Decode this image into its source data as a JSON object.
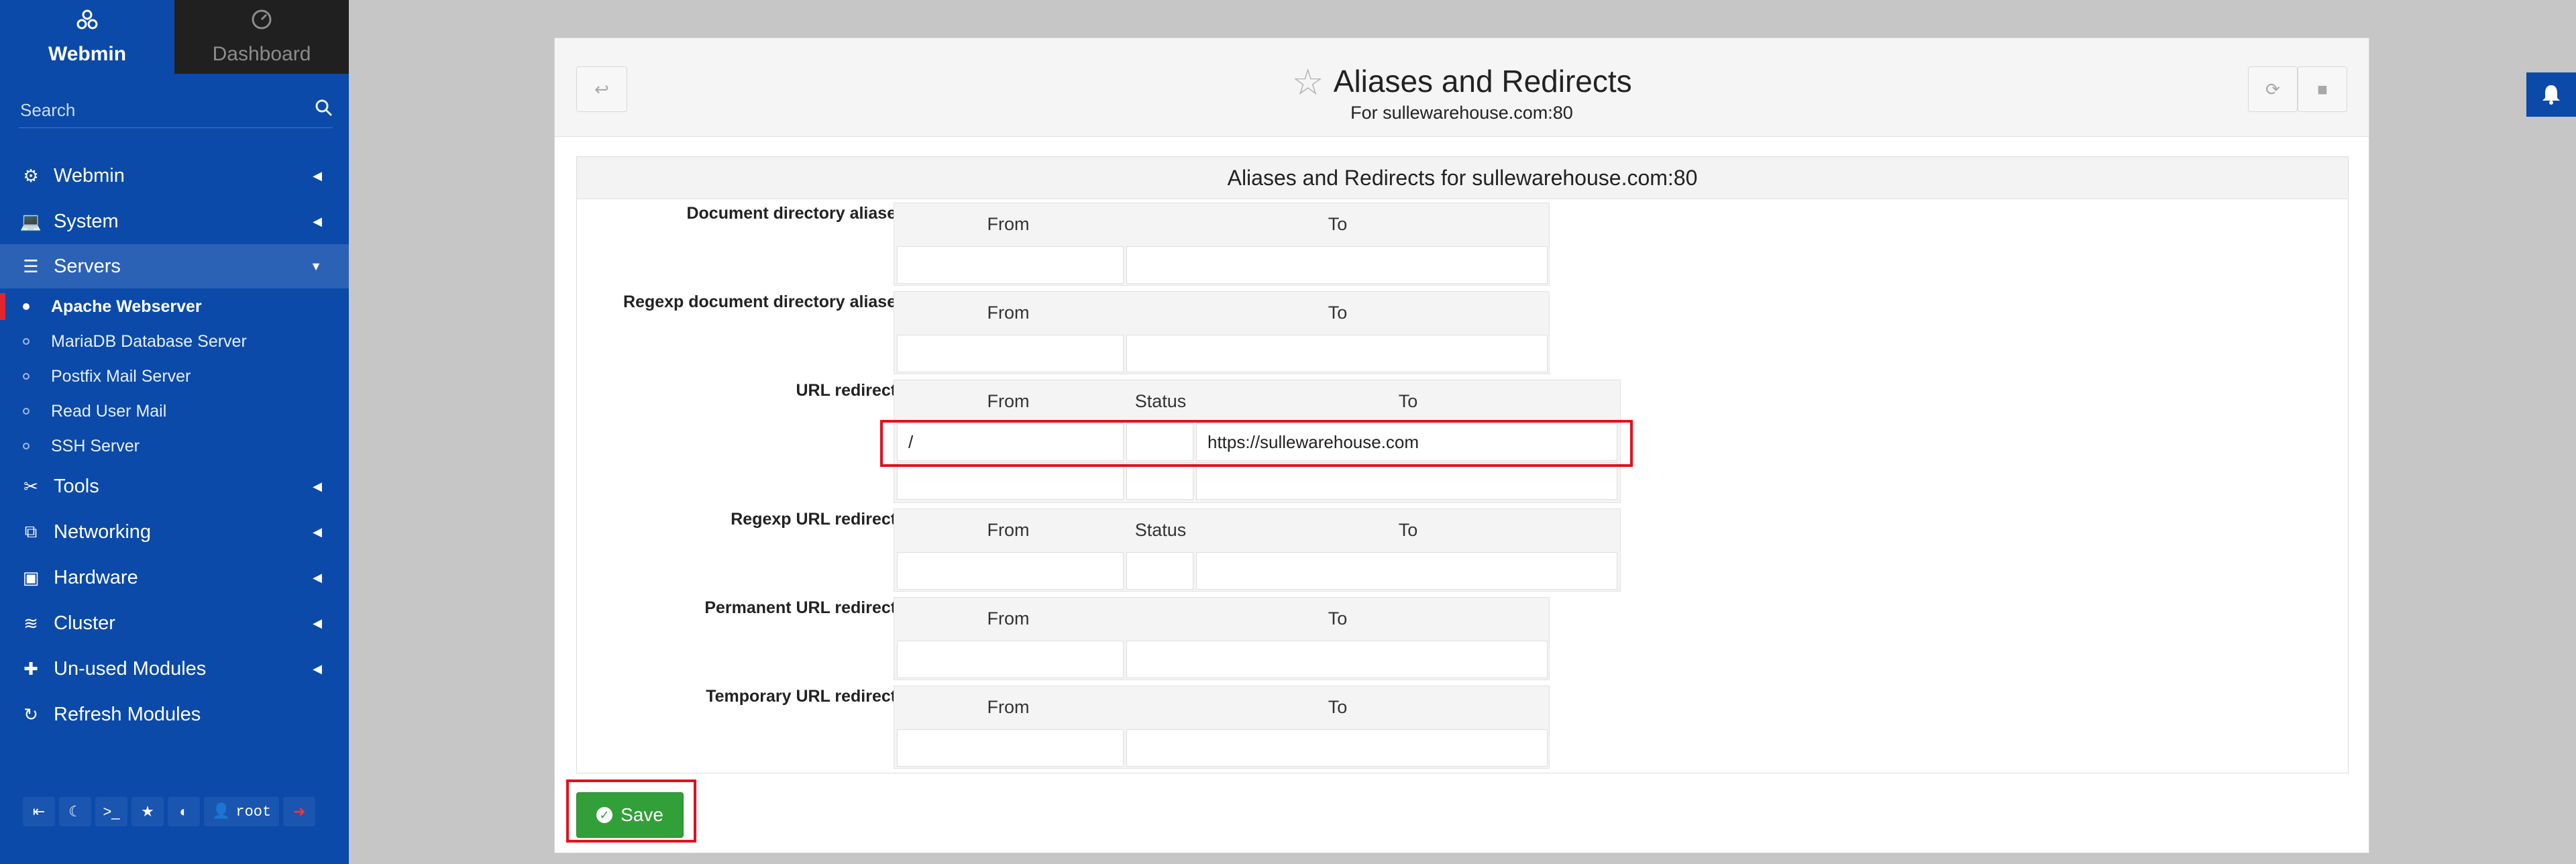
{
  "nav": {
    "webmin_tab": "Webmin",
    "dashboard_tab": "Dashboard",
    "search_placeholder": "Search"
  },
  "menu": {
    "webmin": "Webmin",
    "system": "System",
    "servers": "Servers",
    "servers_sub": [
      "Apache Webserver",
      "MariaDB Database Server",
      "Postfix Mail Server",
      "Read User Mail",
      "SSH Server"
    ],
    "tools": "Tools",
    "networking": "Networking",
    "hardware": "Hardware",
    "cluster": "Cluster",
    "unused": "Un-used Modules",
    "refresh": "Refresh Modules"
  },
  "bottom_bar": {
    "user": "root",
    "icons": [
      "collapse-icon",
      "moon-icon",
      "terminal-icon",
      "star-icon",
      "palette-icon",
      "user-icon",
      "logout-icon"
    ]
  },
  "page": {
    "title": "Aliases and Redirects",
    "subtitle": "For sullewarehouse.com:80",
    "form_title": "Aliases and Redirects for sullewarehouse.com:80",
    "save": "Save"
  },
  "sections": [
    {
      "label": "Document directory aliases",
      "headers": [
        "From",
        "To"
      ]
    },
    {
      "label": "Regexp document directory aliases",
      "headers": [
        "From",
        "To"
      ]
    },
    {
      "label": "URL redirects",
      "headers": [
        "From",
        "Status",
        "To"
      ],
      "rows": [
        [
          "/",
          "",
          "https://sullewarehouse.com"
        ],
        [
          "",
          "",
          ""
        ]
      ]
    },
    {
      "label": "Regexp URL redirects",
      "headers": [
        "From",
        "Status",
        "To"
      ]
    },
    {
      "label": "Permanent URL redirects",
      "headers": [
        "From",
        "To"
      ]
    },
    {
      "label": "Temporary URL redirects",
      "headers": [
        "From",
        "To"
      ]
    }
  ],
  "colors": {
    "sidebar": "#0b4aa8",
    "active_menu": "#2b62b6",
    "save_green": "#31a038",
    "highlight_red": "#e3101c"
  }
}
